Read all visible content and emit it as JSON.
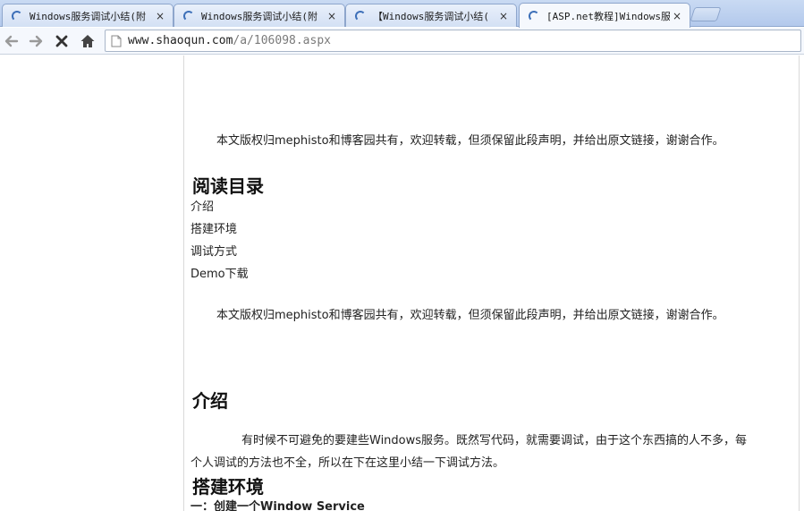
{
  "browser": {
    "tabs": [
      {
        "title": "Windows服务调试小结(附",
        "close": "×",
        "active": false
      },
      {
        "title": "Windows服务调试小结(附",
        "close": "×",
        "active": false
      },
      {
        "title": "【Windows服务调试小结(",
        "close": "×",
        "active": false
      },
      {
        "title": "[ASP.net教程]Windows服务",
        "close": "×",
        "active": true
      }
    ],
    "url_host": "www.shaoqun.com",
    "url_path": "/a/106098.aspx",
    "icons": {
      "back": "back-arrow-icon",
      "forward": "forward-arrow-icon",
      "stop": "stop-x-icon",
      "home": "home-icon",
      "page": "page-icon"
    }
  },
  "article": {
    "copyright_1": "本文版权归mephisto和博客园共有，欢迎转载，但须保留此段声明，并给出原文链接，谢谢合作。",
    "toc_heading": "阅读目录",
    "toc": [
      "介绍",
      "搭建环境",
      "调试方式",
      "Demo下载"
    ],
    "copyright_2": "本文版权归mephisto和博客园共有，欢迎转载，但须保留此段声明，并给出原文链接，谢谢合作。",
    "intro_heading": "介绍",
    "intro_line1": "有时候不可避免的要建些Windows服务。既然写代码，就需要调试，由于这个东西搞的人不多，每",
    "intro_line2": "个人调试的方法也不全，所以在下在这里小结一下调试方法。",
    "setup_heading": "搭建环境",
    "step1": "一：创建一个Window Service"
  }
}
